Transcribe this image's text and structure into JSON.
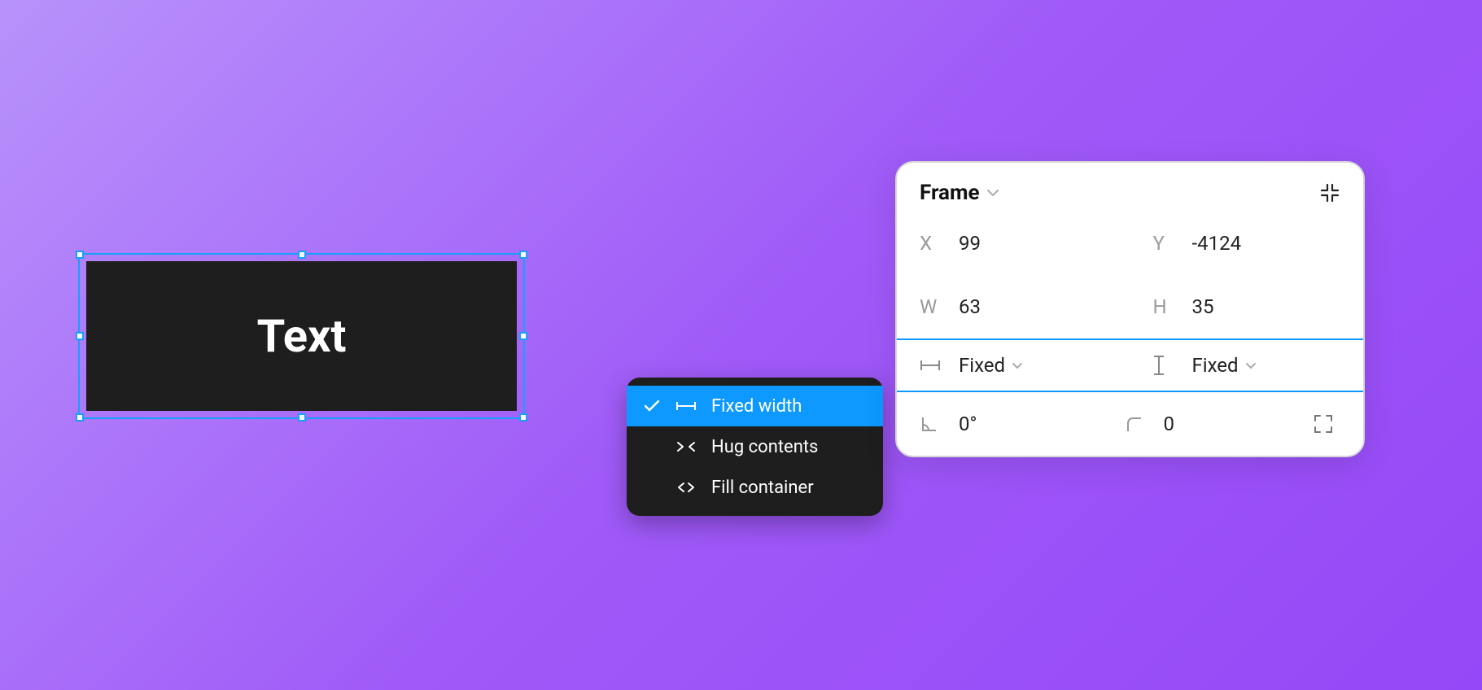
{
  "canvas": {
    "frame_text": "Text"
  },
  "context_menu": {
    "items": [
      {
        "label": "Fixed width",
        "selected": true
      },
      {
        "label": "Hug contents",
        "selected": false
      },
      {
        "label": "Fill container",
        "selected": false
      }
    ]
  },
  "props": {
    "title": "Frame",
    "x_label": "X",
    "x_value": "99",
    "y_label": "Y",
    "y_value": "-4124",
    "w_label": "W",
    "w_value": "63",
    "h_label": "H",
    "h_value": "35",
    "sizing_horizontal": "Fixed",
    "sizing_vertical": "Fixed",
    "rotation_value": "0°",
    "corner_value": "0"
  }
}
